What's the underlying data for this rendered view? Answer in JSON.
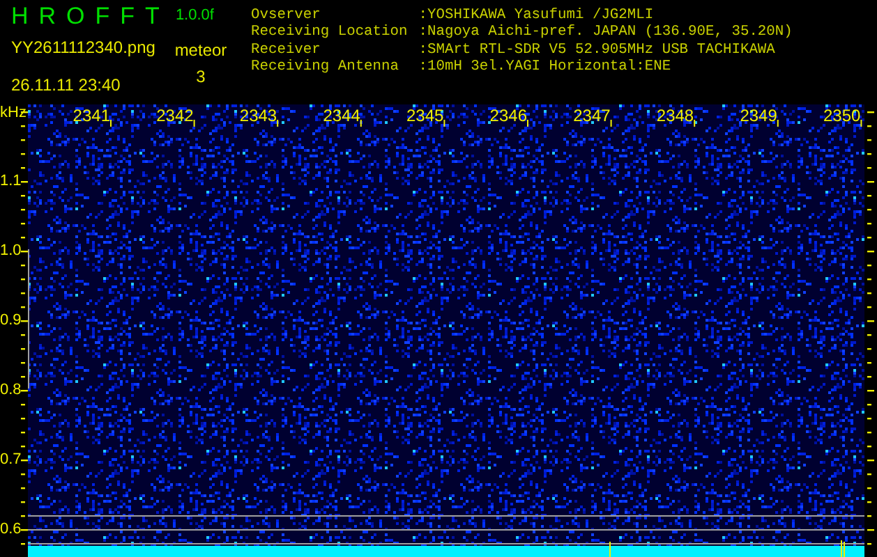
{
  "app": {
    "title": "HROFFT",
    "version": "1.0.0f",
    "file_name": "YY2611112340.png",
    "timestamp": "26.11.11 23:40",
    "meteor_label": "meteor",
    "meteor_count": "3"
  },
  "station": [
    {
      "label": "Ovserver",
      "value": ":YOSHIKAWA Yasufumi /JG2MLI"
    },
    {
      "label": "Receiving Location",
      "value": ":Nagoya Aichi-pref. JAPAN (136.90E, 35.20N)"
    },
    {
      "label": "Receiver",
      "value": ":SMArt RTL-SDR V5 52.905MHz USB TACHIKAWA"
    },
    {
      "label": "Receiving Antenna",
      "value": ":10mH 3el.YAGI Horizontal:ENE"
    }
  ],
  "plot": {
    "unit": "kHz",
    "time_labels": [
      "2341",
      "2342",
      "2343",
      "2344",
      "2345",
      "2346",
      "2347",
      "2348",
      "2349",
      "2350"
    ],
    "freq_labels": [
      "1.1",
      "1.0",
      "0.9",
      "0.8",
      "0.7",
      "0.6"
    ]
  }
}
